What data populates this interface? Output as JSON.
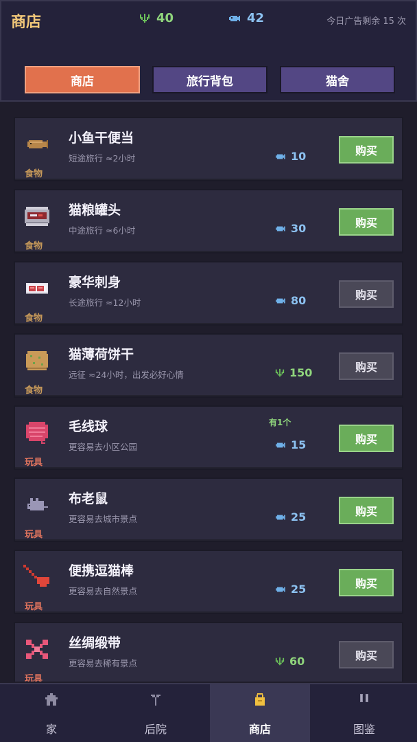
{
  "header": {
    "title": "商店",
    "grass_count": "40",
    "fish_count": "42",
    "ad_text": "今日广告剩余 15 次"
  },
  "tabs": [
    "商店",
    "旅行背包",
    "猫舍"
  ],
  "items": [
    {
      "icon": "dried-fish-bento-icon",
      "category": "食物",
      "name": "小鱼干便当",
      "desc": "短途旅行 ≈2小时",
      "currency": "fish",
      "price": "10",
      "buy": "购买",
      "affordable": true
    },
    {
      "icon": "cat-food-can-icon",
      "category": "食物",
      "name": "猫粮罐头",
      "desc": "中途旅行 ≈6小时",
      "currency": "fish",
      "price": "30",
      "buy": "购买",
      "affordable": true
    },
    {
      "icon": "sashimi-icon",
      "category": "食物",
      "name": "豪华刺身",
      "desc": "长途旅行 ≈12小时",
      "currency": "fish",
      "price": "80",
      "buy": "购买",
      "affordable": false
    },
    {
      "icon": "catnip-cookie-icon",
      "category": "食物",
      "name": "猫薄荷饼干",
      "desc": "远征 ≈24小时，出发必好心情",
      "currency": "grass",
      "price": "150",
      "buy": "购买",
      "affordable": false
    },
    {
      "icon": "yarn-ball-icon",
      "category": "玩具",
      "name": "毛线球",
      "desc": "更容易去小区公园",
      "currency": "fish",
      "price": "15",
      "buy": "购买",
      "affordable": true,
      "owned": "有1个"
    },
    {
      "icon": "cloth-mouse-icon",
      "category": "玩具",
      "name": "布老鼠",
      "desc": "更容易去城市景点",
      "currency": "fish",
      "price": "25",
      "buy": "购买",
      "affordable": true
    },
    {
      "icon": "cat-teaser-icon",
      "category": "玩具",
      "name": "便携逗猫棒",
      "desc": "更容易去自然景点",
      "currency": "fish",
      "price": "25",
      "buy": "购买",
      "affordable": true
    },
    {
      "icon": "silk-ribbon-icon",
      "category": "玩具",
      "name": "丝绸缎带",
      "desc": "更容易去稀有景点",
      "currency": "grass",
      "price": "60",
      "buy": "购买",
      "affordable": false
    }
  ],
  "nav": [
    {
      "icon": "house-icon",
      "label": "家"
    },
    {
      "icon": "sprout-icon",
      "label": "后院"
    },
    {
      "icon": "shopping-bag-icon",
      "label": "商店",
      "active": true
    },
    {
      "icon": "book-icon",
      "label": "图鉴"
    }
  ],
  "colors": {
    "accent": "#e1714d",
    "tab": "#534784",
    "buy_enabled": "#6aad5a",
    "buy_disabled": "#4a4857",
    "fish": "#8cc1f0",
    "grass": "#8fd47c"
  }
}
